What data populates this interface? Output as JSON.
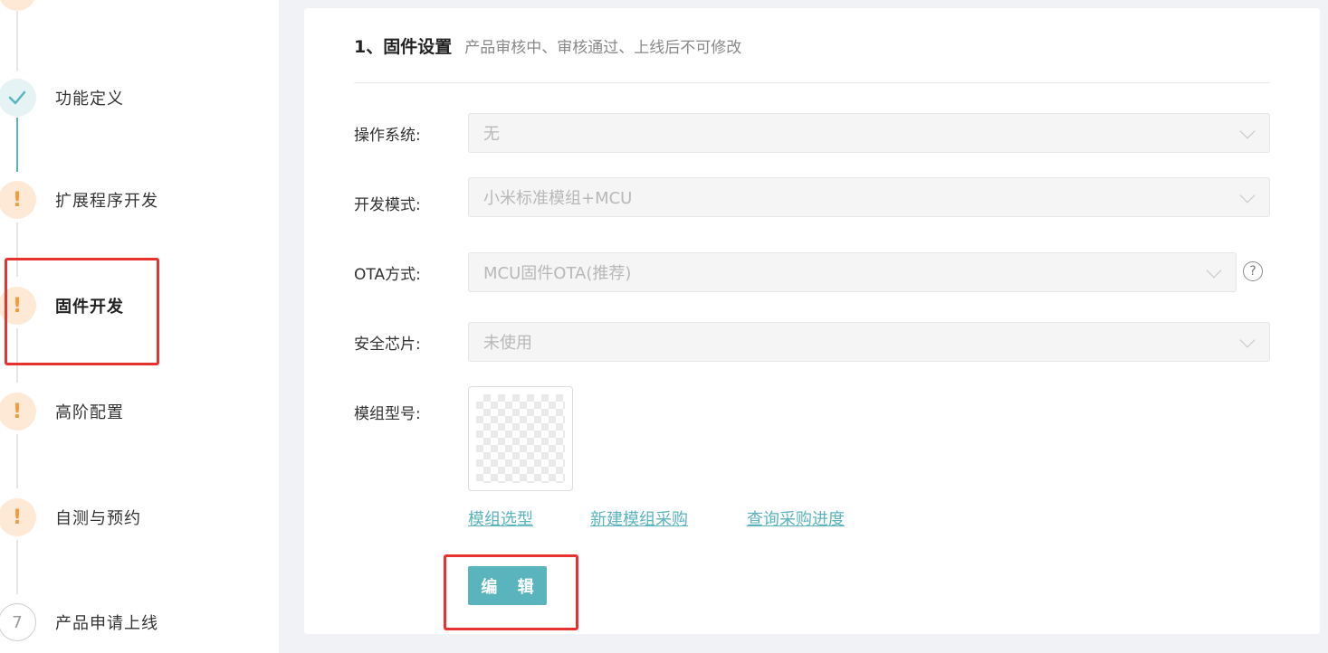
{
  "sidebar": {
    "steps": [
      {
        "label": "功能定义",
        "status": "done"
      },
      {
        "label": "扩展程序开发",
        "status": "warn",
        "icon": "!"
      },
      {
        "label": "固件开发",
        "status": "warn",
        "icon": "!",
        "active": true
      },
      {
        "label": "高阶配置",
        "status": "warn",
        "icon": "!"
      },
      {
        "label": "自测与预约",
        "status": "warn",
        "icon": "!"
      },
      {
        "label": "产品申请上线",
        "status": "pending",
        "number": "7"
      }
    ]
  },
  "section": {
    "title": "1、固件设置",
    "subtitle": "产品审核中、审核通过、上线后不可修改"
  },
  "form": {
    "os": {
      "label": "操作系统:",
      "value": "无"
    },
    "dev_mode": {
      "label": "开发模式:",
      "value": "小米标准模组+MCU"
    },
    "ota": {
      "label": "OTA方式:",
      "value": "MCU固件OTA(推荐)",
      "help": "?"
    },
    "security_chip": {
      "label": "安全芯片:",
      "value": "未使用"
    },
    "module_model": {
      "label": "模组型号:"
    }
  },
  "links": {
    "select_module": "模组选型",
    "new_purchase": "新建模组采购",
    "query_progress": "查询采购进度"
  },
  "actions": {
    "edit": "编 辑"
  },
  "colors": {
    "accent": "#5ab4be",
    "warn": "#f39b3c",
    "highlight": "#e7332f"
  }
}
